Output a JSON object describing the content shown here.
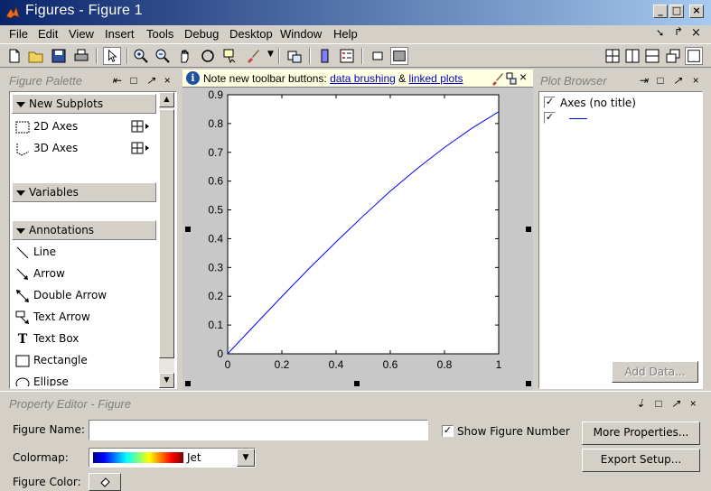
{
  "window": {
    "title": "Figures - Figure 1",
    "minimize": "_",
    "maximize": "□",
    "close": "×"
  },
  "menu": [
    "File",
    "Edit",
    "View",
    "Insert",
    "Tools",
    "Debug",
    "Desktop",
    "Window",
    "Help"
  ],
  "figure_palette": {
    "title": "Figure Palette",
    "sections": {
      "new_subplots": "New Subplots",
      "variables": "Variables",
      "annotations": "Annotations"
    },
    "subplots": [
      "2D Axes",
      "3D Axes"
    ],
    "annotations": [
      "Line",
      "Arrow",
      "Double Arrow",
      "Text Arrow",
      "Text Box",
      "Rectangle",
      "Ellipse"
    ]
  },
  "notice": {
    "prefix": "Note new toolbar buttons: ",
    "link1": "data brushing",
    "amp": " & ",
    "link2": "linked plots"
  },
  "plot_browser": {
    "title": "Plot Browser",
    "axes_label": "Axes (no title)",
    "add_data": "Add Data..."
  },
  "property_editor": {
    "title": "Property Editor - Figure",
    "figure_name_label": "Figure Name:",
    "figure_name_value": "",
    "show_figure_number": "Show Figure Number",
    "colormap_label": "Colormap:",
    "colormap_value": "Jet",
    "figure_color_label": "Figure Color:",
    "more_properties": "More Properties...",
    "export_setup": "Export Setup..."
  },
  "chart_data": {
    "type": "line",
    "title": "",
    "xlabel": "",
    "ylabel": "",
    "xlim": [
      0,
      1
    ],
    "ylim": [
      0,
      0.9
    ],
    "xticks": [
      "0",
      "0.2",
      "0.4",
      "0.6",
      "0.8",
      "1"
    ],
    "yticks": [
      "0",
      "0.1",
      "0.2",
      "0.3",
      "0.4",
      "0.5",
      "0.6",
      "0.7",
      "0.8",
      "0.9"
    ],
    "line_color": "#0000ff",
    "series": [
      {
        "x": [
          0,
          0.1,
          0.2,
          0.3,
          0.4,
          0.5,
          0.6,
          0.7,
          0.8,
          0.9,
          1.0
        ],
        "values": [
          0,
          0.1,
          0.199,
          0.296,
          0.389,
          0.479,
          0.565,
          0.644,
          0.717,
          0.783,
          0.841
        ]
      }
    ]
  }
}
